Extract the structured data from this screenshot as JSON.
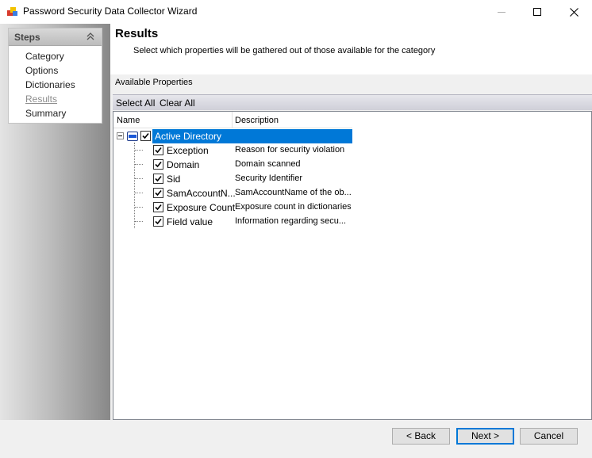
{
  "window": {
    "title": "Password Security Data Collector Wizard",
    "icon": "app-wizard-icon",
    "controls": [
      "minimize-icon",
      "maximize-icon",
      "close-icon"
    ]
  },
  "steps": {
    "title": "Steps",
    "items": [
      {
        "label": "Category",
        "state": "done"
      },
      {
        "label": "Options",
        "state": "done"
      },
      {
        "label": "Dictionaries",
        "state": "done"
      },
      {
        "label": "Results",
        "state": "current"
      },
      {
        "label": "Summary",
        "state": "pending"
      }
    ]
  },
  "page": {
    "title": "Results",
    "subtitle": "Select which properties will be gathered out of those available for the category"
  },
  "properties": {
    "label": "Available Properties",
    "select_all": "Select All",
    "clear_all": "Clear All",
    "columns": {
      "name": "Name",
      "description": "Description"
    },
    "root": {
      "label": "Active Directory",
      "checked": true,
      "expanded": true,
      "selected": true
    },
    "items": [
      {
        "label": "Exception",
        "description": "Reason for security violation",
        "checked": true
      },
      {
        "label": "Domain",
        "description": "Domain scanned",
        "checked": true
      },
      {
        "label": "Sid",
        "description": "Security Identifier",
        "checked": true
      },
      {
        "label": "SamAccountN...",
        "description": "SamAccountName of the ob...",
        "checked": true
      },
      {
        "label": "Exposure Count",
        "description": "Exposure count in dictionaries",
        "checked": true
      },
      {
        "label": "Field value",
        "description": "Information regarding secu...",
        "checked": true
      }
    ]
  },
  "buttons": {
    "back": "< Back",
    "next": "Next >",
    "cancel": "Cancel"
  },
  "colors": {
    "selection": "#0078d7",
    "focus_border": "#0078d7"
  }
}
